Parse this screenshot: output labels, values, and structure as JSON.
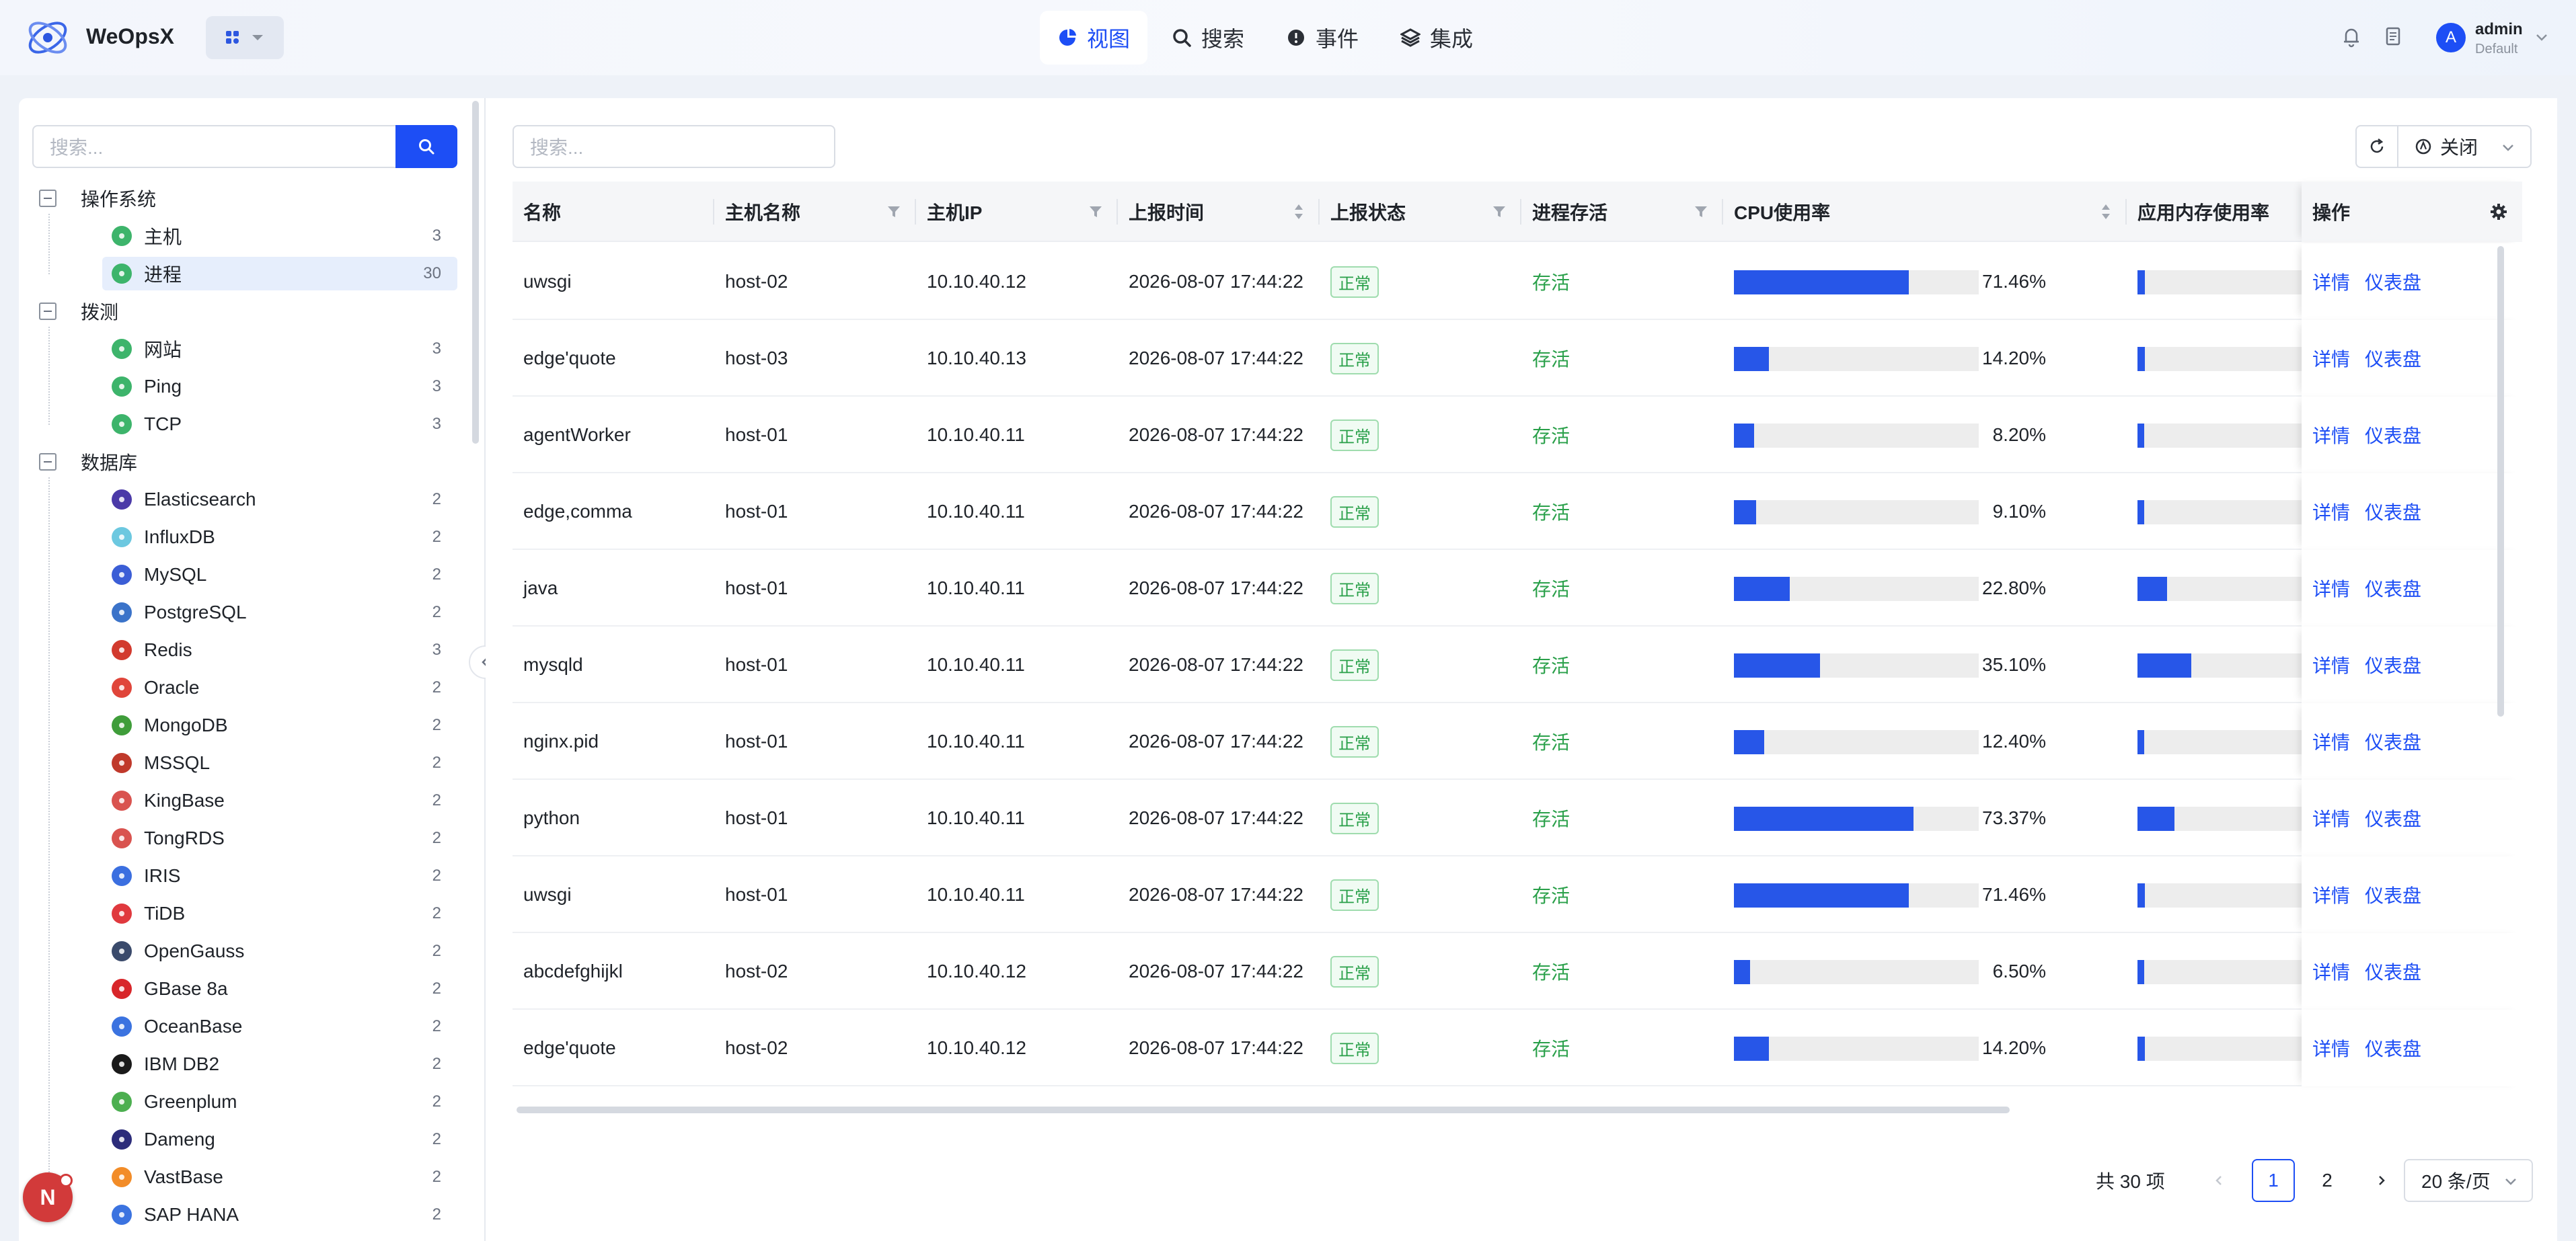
{
  "app": {
    "name": "WeOpsX"
  },
  "nav": [
    {
      "label": "视图",
      "icon": "pie-chart-icon",
      "active": true
    },
    {
      "label": "搜索",
      "icon": "search-icon",
      "active": false
    },
    {
      "label": "事件",
      "icon": "event-icon",
      "active": false
    },
    {
      "label": "集成",
      "icon": "layers-icon",
      "active": false
    }
  ],
  "user": {
    "avatar": "A",
    "name": "admin",
    "tenant": "Default"
  },
  "sidebar": {
    "search_placeholder": "搜索...",
    "groups": [
      {
        "label": "操作系统",
        "items": [
          {
            "label": "主机",
            "count": "3",
            "icon": "os-icon",
            "color": "#3db46b",
            "selected": false
          },
          {
            "label": "进程",
            "count": "30",
            "icon": "process-icon",
            "color": "#3db46b",
            "selected": true
          }
        ]
      },
      {
        "label": "拨测",
        "items": [
          {
            "label": "网站",
            "count": "3",
            "icon": "globe-icon",
            "color": "#3db46b"
          },
          {
            "label": "Ping",
            "count": "3",
            "icon": "globe-icon",
            "color": "#3db46b"
          },
          {
            "label": "TCP",
            "count": "3",
            "icon": "globe-icon",
            "color": "#3db46b"
          }
        ]
      },
      {
        "label": "数据库",
        "items": [
          {
            "label": "Elasticsearch",
            "count": "2",
            "icon": "elasticsearch-icon",
            "color": "#4b3aa8"
          },
          {
            "label": "InfluxDB",
            "count": "2",
            "icon": "influxdb-icon",
            "color": "#6cc8e0"
          },
          {
            "label": "MySQL",
            "count": "2",
            "icon": "mysql-icon",
            "color": "#3b5ed6"
          },
          {
            "label": "PostgreSQL",
            "count": "2",
            "icon": "postgresql-icon",
            "color": "#3b73c9"
          },
          {
            "label": "Redis",
            "count": "3",
            "icon": "redis-icon",
            "color": "#d23a2e"
          },
          {
            "label": "Oracle",
            "count": "2",
            "icon": "oracle-icon",
            "color": "#e0453a"
          },
          {
            "label": "MongoDB",
            "count": "2",
            "icon": "mongodb-icon",
            "color": "#3f9d3a"
          },
          {
            "label": "MSSQL",
            "count": "2",
            "icon": "mssql-icon",
            "color": "#c0392b"
          },
          {
            "label": "KingBase",
            "count": "2",
            "icon": "kingbase-icon",
            "color": "#d9534f"
          },
          {
            "label": "TongRDS",
            "count": "2",
            "icon": "tongrds-icon",
            "color": "#d9534f"
          },
          {
            "label": "IRIS",
            "count": "2",
            "icon": "iris-icon",
            "color": "#3b6fe0"
          },
          {
            "label": "TiDB",
            "count": "2",
            "icon": "tidb-icon",
            "color": "#e0393e"
          },
          {
            "label": "OpenGauss",
            "count": "2",
            "icon": "opengauss-icon",
            "color": "#3a4a6b"
          },
          {
            "label": "GBase 8a",
            "count": "2",
            "icon": "gbase-icon",
            "color": "#d8262a"
          },
          {
            "label": "OceanBase",
            "count": "2",
            "icon": "oceanbase-icon",
            "color": "#3b73e0"
          },
          {
            "label": "IBM DB2",
            "count": "2",
            "icon": "ibm-db2-icon",
            "color": "#1a1a1a"
          },
          {
            "label": "Greenplum",
            "count": "2",
            "icon": "greenplum-icon",
            "color": "#4caf50"
          },
          {
            "label": "Dameng",
            "count": "2",
            "icon": "dameng-icon",
            "color": "#2c2c7a"
          },
          {
            "label": "VastBase",
            "count": "2",
            "icon": "vastbase-icon",
            "color": "#f28c28"
          },
          {
            "label": "SAP HANA",
            "count": "2",
            "icon": "sap-hana-icon",
            "color": "#3b73e0"
          }
        ]
      }
    ]
  },
  "main": {
    "search_placeholder": "搜索...",
    "auto_refresh_label": "关闭",
    "columns": [
      "名称",
      "主机名称",
      "主机IP",
      "上报时间",
      "上报状态",
      "进程存活",
      "CPU使用率",
      "应用内存使用率",
      "操作"
    ],
    "rows": [
      {
        "name": "uwsgi",
        "host": "host-02",
        "ip": "10.10.40.12",
        "time": "2026-08-07 17:44:22",
        "status": "正常",
        "alive": "存活",
        "cpu": "71.46%",
        "cpu_v": 71.46,
        "mem_v": 3
      },
      {
        "name": "edge'quote",
        "host": "host-03",
        "ip": "10.10.40.13",
        "time": "2026-08-07 17:44:22",
        "status": "正常",
        "alive": "存活",
        "cpu": "14.20%",
        "cpu_v": 14.2,
        "mem_v": 3
      },
      {
        "name": "agentWorker",
        "host": "host-01",
        "ip": "10.10.40.11",
        "time": "2026-08-07 17:44:22",
        "status": "正常",
        "alive": "存活",
        "cpu": "8.20%",
        "cpu_v": 8.2,
        "mem_v": 2
      },
      {
        "name": "edge,comma",
        "host": "host-01",
        "ip": "10.10.40.11",
        "time": "2026-08-07 17:44:22",
        "status": "正常",
        "alive": "存活",
        "cpu": "9.10%",
        "cpu_v": 9.1,
        "mem_v": 2
      },
      {
        "name": "java",
        "host": "host-01",
        "ip": "10.10.40.11",
        "time": "2026-08-07 17:44:22",
        "status": "正常",
        "alive": "存活",
        "cpu": "22.80%",
        "cpu_v": 22.8,
        "mem_v": 12
      },
      {
        "name": "mysqld",
        "host": "host-01",
        "ip": "10.10.40.11",
        "time": "2026-08-07 17:44:22",
        "status": "正常",
        "alive": "存活",
        "cpu": "35.10%",
        "cpu_v": 35.1,
        "mem_v": 22
      },
      {
        "name": "nginx.pid",
        "host": "host-01",
        "ip": "10.10.40.11",
        "time": "2026-08-07 17:44:22",
        "status": "正常",
        "alive": "存活",
        "cpu": "12.40%",
        "cpu_v": 12.4,
        "mem_v": 1
      },
      {
        "name": "python",
        "host": "host-01",
        "ip": "10.10.40.11",
        "time": "2026-08-07 17:44:22",
        "status": "正常",
        "alive": "存活",
        "cpu": "73.37%",
        "cpu_v": 73.37,
        "mem_v": 15
      },
      {
        "name": "uwsgi",
        "host": "host-01",
        "ip": "10.10.40.11",
        "time": "2026-08-07 17:44:22",
        "status": "正常",
        "alive": "存活",
        "cpu": "71.46%",
        "cpu_v": 71.46,
        "mem_v": 3
      },
      {
        "name": "abcdefghijkl",
        "host": "host-02",
        "ip": "10.10.40.12",
        "time": "2026-08-07 17:44:22",
        "status": "正常",
        "alive": "存活",
        "cpu": "6.50%",
        "cpu_v": 6.5,
        "mem_v": 1
      },
      {
        "name": "edge'quote",
        "host": "host-02",
        "ip": "10.10.40.12",
        "time": "2026-08-07 17:44:22",
        "status": "正常",
        "alive": "存活",
        "cpu": "14.20%",
        "cpu_v": 14.2,
        "mem_v": 3
      }
    ],
    "actions": {
      "detail": "详情",
      "dashboard": "仪表盘"
    },
    "pagination": {
      "total": "共 30 项",
      "pages": [
        "1",
        "2"
      ],
      "current": "1",
      "page_size": "20 条/页"
    }
  },
  "float_badge": "N"
}
